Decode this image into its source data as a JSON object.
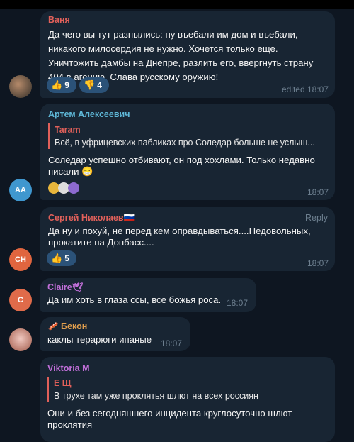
{
  "messages": [
    {
      "author": "Ваня",
      "lines": [
        "Да чего вы тут разнылись: ну въебали им дом и въебали,",
        "никакого милосердия не нужно. Хочется только еще.",
        "Уничтожить дамбы на Днепре, разлить его, ввергнуть страну",
        "404 в агонию. Слава русскому оружию!"
      ],
      "reactions": [
        {
          "icon": "thumbs-up",
          "glyph": "👍",
          "count": "9"
        },
        {
          "icon": "thumbs-down",
          "glyph": "👎",
          "count": "4"
        }
      ],
      "time": "edited 18:07"
    },
    {
      "author": "Артем Алексеевич",
      "reply": {
        "name": "Taram",
        "text": "Всё, в уфрицевских пабликах про Соледар больше не услыш..."
      },
      "lines": [
        "Соледар успешно отбивают, он под хохлами. Только недавно",
        "писали 😁"
      ],
      "avatar_initials": "AA",
      "time": "18:07"
    },
    {
      "author": "Сергей Николаев🇷🇺",
      "reply_label": "Reply",
      "lines": [
        "Да ну и похуй, не перед кем оправдываться....Недовольных,",
        "прокатите на Донбасс...."
      ],
      "reactions": [
        {
          "icon": "thumbs-up",
          "glyph": "👍",
          "count": "5"
        }
      ],
      "avatar_initials": "CH",
      "time": "18:07"
    },
    {
      "author": "Claire🕊",
      "lines": [
        "Да им хоть в глаза ссы, все божья роса."
      ],
      "avatar_initials": "C",
      "time": "18:07"
    },
    {
      "author": "🥓 Бекон",
      "lines": [
        "каклы терарюги ипаные"
      ],
      "time": "18:07"
    },
    {
      "author": "Viktoria M",
      "reply": {
        "name": "Е Щ",
        "text": "В трухе там уже проклятья шлют на всех россиян"
      },
      "lines": [
        "Они и без сегодняшнего инцидента круглосуточно шлют",
        "проклятия"
      ]
    }
  ],
  "colors": {
    "background": "#0e1621",
    "bubble": "#182533",
    "name_vanya": "#e0605a",
    "name_artem": "#5fb8d8",
    "name_sergey": "#e0605a",
    "name_claire": "#c06fd8",
    "name_bekon": "#e3a04e",
    "name_viktoria": "#c06fd8"
  }
}
